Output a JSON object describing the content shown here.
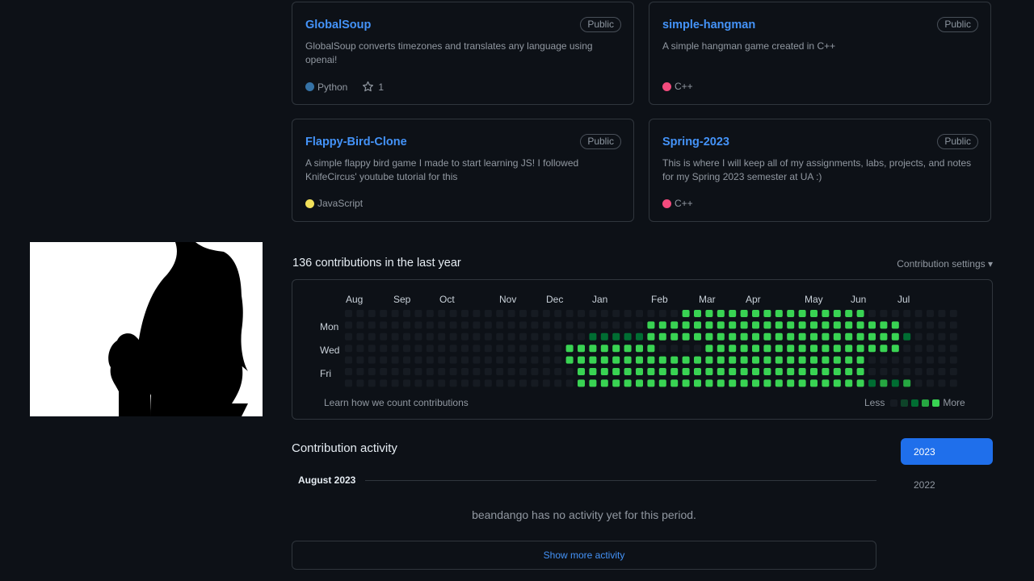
{
  "repos": [
    {
      "name": "GlobalSoup",
      "badge": "Public",
      "description": "GlobalSoup converts timezones and translates any language using openai!",
      "language": "Python",
      "language_color": "#3572A5",
      "stars": "1"
    },
    {
      "name": "simple-hangman",
      "badge": "Public",
      "description": "A simple hangman game created in C++",
      "language": "C++",
      "language_color": "#f34b7d"
    },
    {
      "name": "Flappy-Bird-Clone",
      "badge": "Public",
      "description": "A simple flappy bird game I made to start learning JS! I followed KnifeCircus' youtube tutorial for this",
      "language": "JavaScript",
      "language_color": "#f1e05a"
    },
    {
      "name": "Spring-2023",
      "badge": "Public",
      "description": "This is where I will keep all of my assignments, labs, projects, and notes for my Spring 2023 semester at UA :)",
      "language": "C++",
      "language_color": "#f34b7d"
    }
  ],
  "contributions": {
    "title": "136 contributions in the last year",
    "settings_label": "Contribution settings ▾",
    "months": [
      "Aug",
      "Sep",
      "Oct",
      "Nov",
      "Dec",
      "Jan",
      "Feb",
      "Mar",
      "Apr",
      "May",
      "Jun",
      "Jul"
    ],
    "day_labels": [
      "Mon",
      "Wed",
      "Fri"
    ],
    "learn_link": "Learn how we count contributions",
    "legend_less": "Less",
    "legend_more": "More",
    "level_colors": [
      "#161b22",
      "#0e4429",
      "#006d32",
      "#26a641",
      "#39d353"
    ]
  },
  "activity": {
    "title": "Contribution activity",
    "period": "August 2023",
    "empty_message": "beandango has no activity yet for this period.",
    "show_more": "Show more activity",
    "years": [
      "2023",
      "2022"
    ],
    "selected_year": "2023"
  }
}
